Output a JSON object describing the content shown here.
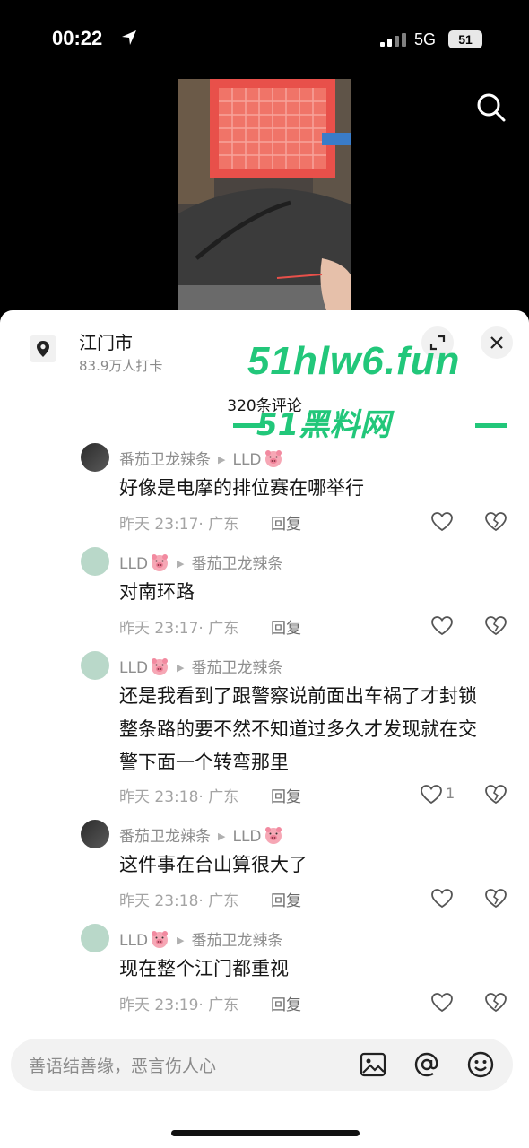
{
  "status_bar": {
    "time": "00:22",
    "network": "5G",
    "battery": "51"
  },
  "location": {
    "name": "江门市",
    "subtitle": "83.9万人打卡"
  },
  "comments_count": "320条评论",
  "watermark": {
    "main": "51hlw6.fun",
    "sub": "51黑料网"
  },
  "comments": [
    {
      "author": "番茄卫龙辣条",
      "reply_to": "LLD",
      "text": "好像是电摩的排位赛在哪举行",
      "time": "昨天 23:17· 广东",
      "reply_label": "回复",
      "likes": ""
    },
    {
      "author": "LLD",
      "reply_to": "番茄卫龙辣条",
      "text": "对南环路",
      "time": "昨天 23:17· 广东",
      "reply_label": "回复",
      "likes": ""
    },
    {
      "author": "LLD",
      "reply_to": "番茄卫龙辣条",
      "text_lines": [
        "还是我看到了跟警察说前面出车祸了才封锁",
        "整条路的要不然不知道过多久才发现就在交",
        "警下面一个转弯那里"
      ],
      "time": "昨天 23:18· 广东",
      "reply_label": "回复",
      "likes": "1"
    },
    {
      "author": "番茄卫龙辣条",
      "reply_to": "LLD",
      "text": "这件事在台山算很大了",
      "time": "昨天 23:18· 广东",
      "reply_label": "回复",
      "likes": ""
    },
    {
      "author": "LLD",
      "reply_to": "番茄卫龙辣条",
      "text": "现在整个江门都重视",
      "time": "昨天 23:19· 广东",
      "reply_label": "回复",
      "likes": ""
    }
  ],
  "input": {
    "placeholder": "善语结善缘，恶言伤人心"
  },
  "icons": {
    "pig": "pig-emoji",
    "at": "at-icon",
    "emoji": "smiley-icon",
    "image": "image-icon"
  }
}
